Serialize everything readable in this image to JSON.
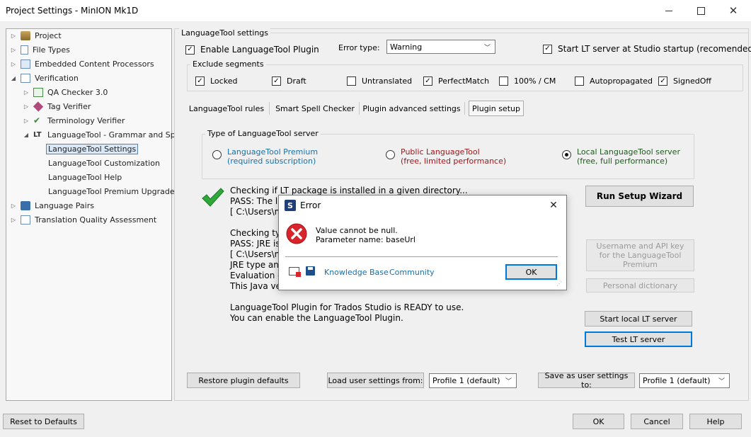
{
  "window": {
    "title": "Project Settings - MinION Mk1D"
  },
  "tree": {
    "items": [
      {
        "label": "Project"
      },
      {
        "label": "File Types"
      },
      {
        "label": "Embedded Content Processors"
      },
      {
        "label": "Verification"
      },
      {
        "label": "QA Checker 3.0"
      },
      {
        "label": "Tag Verifier"
      },
      {
        "label": "Terminology Verifier"
      },
      {
        "label": "LanguageTool - Grammar and Spe"
      },
      {
        "label": "LanguageTool Settings"
      },
      {
        "label": "LanguageTool Customization"
      },
      {
        "label": "LanguageTool Help"
      },
      {
        "label": "LanguageTool Premium Upgrade"
      },
      {
        "label": "Language Pairs"
      },
      {
        "label": "Translation Quality Assessment"
      }
    ]
  },
  "settings": {
    "group_title": "LanguageTool settings",
    "enable_plugin": "Enable LanguageTool Plugin",
    "error_type_label": "Error type:",
    "error_type_value": "Warning",
    "start_server": "Start LT server at Studio startup (recomended)",
    "exclude_title": "Exclude segments",
    "exclude": [
      {
        "label": "Locked",
        "checked": true
      },
      {
        "label": "Draft",
        "checked": true
      },
      {
        "label": "Untranslated",
        "checked": false
      },
      {
        "label": "PerfectMatch",
        "checked": true
      },
      {
        "label": "100% / CM",
        "checked": false
      },
      {
        "label": "Autopropagated",
        "checked": false
      },
      {
        "label": "SignedOff",
        "checked": true
      }
    ]
  },
  "tabs": [
    "LanguageTool rules",
    "Smart Spell Checker",
    "Plugin advanced settings",
    "Plugin setup"
  ],
  "server_type": {
    "title": "Type of LanguageTool server",
    "options": [
      {
        "line1": "LanguageTool Premium",
        "line2": "(required subscription)",
        "color": "#1a6fa8"
      },
      {
        "line1": "Public LanguageTool",
        "line2": "(free, limited performance)",
        "color": "#a0161b"
      },
      {
        "line1": "Local LanguageTool server",
        "line2": "(free, full performance)",
        "color": "#1d5a1d"
      }
    ]
  },
  "log": [
    "Checking if LT package is installed in a given directory...",
    "PASS: The la",
    "[ C:\\Users\\m",
    "",
    "Checking typ",
    "PASS: JRE is",
    "[ C:\\Users\\m",
    "JRE type and",
    "Evaluation of",
    "This Java vers",
    "",
    "LanguageTool Plugin for Trados Studio is READY to use.",
    "You can enable the LanguageTool Plugin."
  ],
  "side_buttons": {
    "run_wizard": "Run Setup Wizard",
    "username_api": "Username and API key for the LanguageTool Premium",
    "personal_dict": "Personal dictionary",
    "start_local": "Start local LT server",
    "test_server": "Test LT server"
  },
  "bottom": {
    "restore": "Restore plugin defaults",
    "load_label": "Load user settings from:",
    "load_value": "Profile 1 (default)",
    "save_label": "Save as user settings to:",
    "save_value": "Profile 1 (default)"
  },
  "footer": {
    "reset": "Reset to Defaults",
    "ok": "OK",
    "cancel": "Cancel",
    "help": "Help"
  },
  "dialog": {
    "title": "Error",
    "message_line1": "Value cannot be null.",
    "message_line2": "Parameter name: baseUrl",
    "knowledge_base": "Knowledge Base",
    "community": "Community",
    "ok": "OK"
  }
}
